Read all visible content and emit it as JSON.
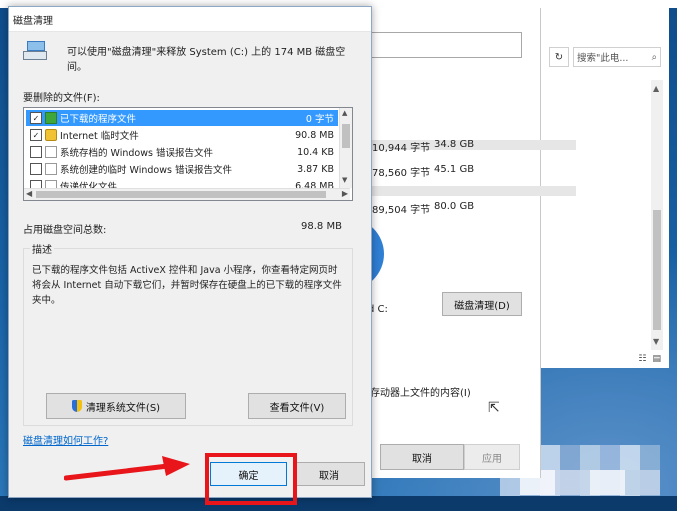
{
  "explorer": {
    "refresh_icon": "↻",
    "search_placeholder": "搜索\"此电...",
    "search_icon": "⌕"
  },
  "properties": {
    "rows": [
      {
        "bytes": "10,944 字节",
        "size": "34.8 GB"
      },
      {
        "bytes": "78,560 字节",
        "size": "45.1 GB"
      },
      {
        "bytes": "89,504 字节",
        "size": "80.0 GB"
      }
    ],
    "drive_label": "d C:",
    "cleanup_button": "磁盘清理(D)",
    "index_text": "存动器上文件的内容(I)",
    "cancel_button": "取消",
    "apply_button": "应用"
  },
  "dialog": {
    "title": "磁盘清理",
    "intro": "可以使用\"磁盘清理\"来释放 System (C:) 上的 174 MB 磁盘空间。",
    "files_label": "要删除的文件(F):",
    "files": [
      {
        "checked": true,
        "name": "已下载的程序文件",
        "size": "0 字节",
        "selected": true
      },
      {
        "checked": true,
        "name": "Internet 临时文件",
        "size": "90.8 MB",
        "selected": false
      },
      {
        "checked": false,
        "name": "系统存档的 Windows 错误报告文件",
        "size": "10.4 KB",
        "selected": false
      },
      {
        "checked": false,
        "name": "系统创建的临时 Windows 错误报告文件",
        "size": "3.87 KB",
        "selected": false
      },
      {
        "checked": false,
        "name": "传递优化文件",
        "size": "6.48 MB",
        "selected": false
      }
    ],
    "total_label": "占用磁盘空间总数:",
    "total_value": "98.8 MB",
    "description_title": "描述",
    "description": "已下载的程序文件包括 ActiveX 控件和 Java 小程序，你查看特定网页时将会从 Internet 自动下载它们，并暂时保存在硬盘上的已下载的程序文件夹中。",
    "system_files_button": "清理系统文件(S)",
    "view_files_button": "查看文件(V)",
    "help_link": "磁盘清理如何工作?",
    "ok_button": "确定",
    "cancel_button": "取消"
  },
  "colors": {
    "selection": "#3399ff",
    "highlight_box": "#e8151b",
    "link": "#0066cc"
  }
}
